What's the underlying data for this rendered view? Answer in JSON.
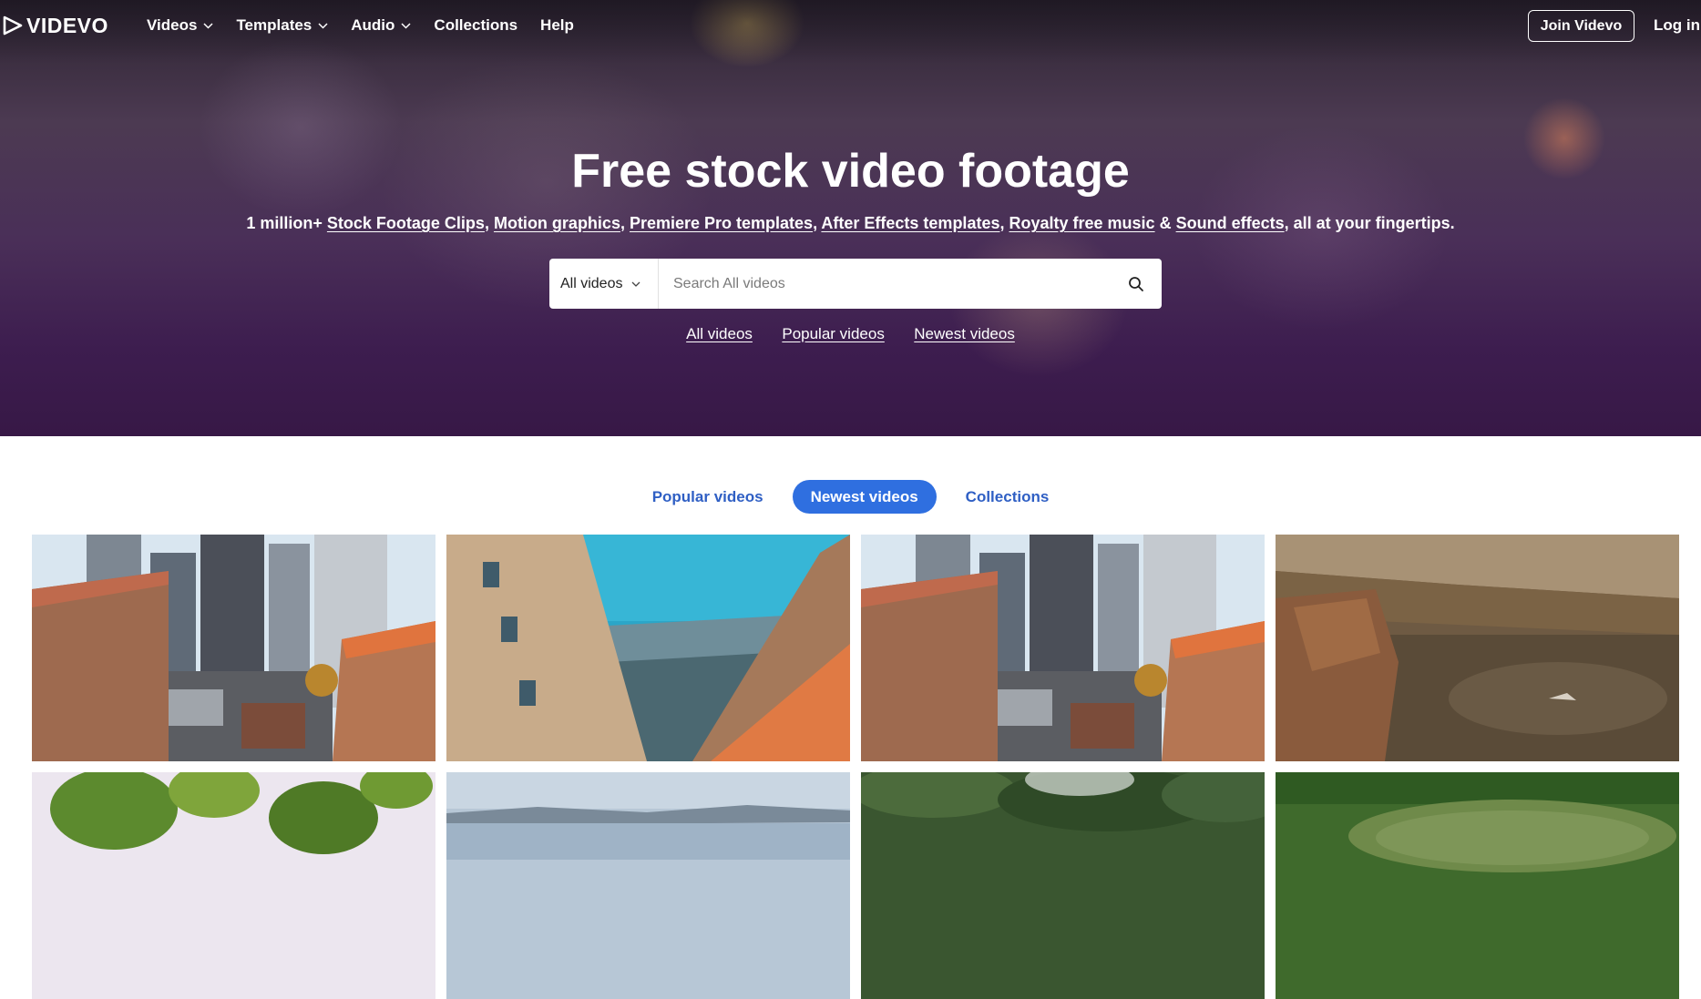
{
  "brand": {
    "name": "VIDEVO"
  },
  "nav": {
    "items": [
      {
        "label": "Videos",
        "has_menu": true
      },
      {
        "label": "Templates",
        "has_menu": true
      },
      {
        "label": "Audio",
        "has_menu": true
      },
      {
        "label": "Collections",
        "has_menu": false
      },
      {
        "label": "Help",
        "has_menu": false
      }
    ],
    "join_label": "Join Videvo",
    "login_label": "Log in"
  },
  "hero": {
    "title": "Free stock video footage",
    "subtitle": {
      "prefix": "1 million+",
      "links": [
        "Stock Footage Clips",
        "Motion graphics",
        "Premiere Pro templates",
        "After Effects templates",
        "Royalty free music",
        "Sound effects"
      ],
      "amp": "&",
      "suffix": ", all at your fingertips."
    },
    "search": {
      "category": "All videos",
      "placeholder": "Search All videos"
    },
    "quick_links": [
      "All videos",
      "Popular videos",
      "Newest videos"
    ]
  },
  "tabs": [
    {
      "label": "Popular videos",
      "active": false
    },
    {
      "label": "Newest videos",
      "active": true
    },
    {
      "label": "Collections",
      "active": false
    }
  ],
  "colors": {
    "accent": "#2f6fe0",
    "link": "#2f5fc4",
    "hero_dark": "#371846"
  }
}
